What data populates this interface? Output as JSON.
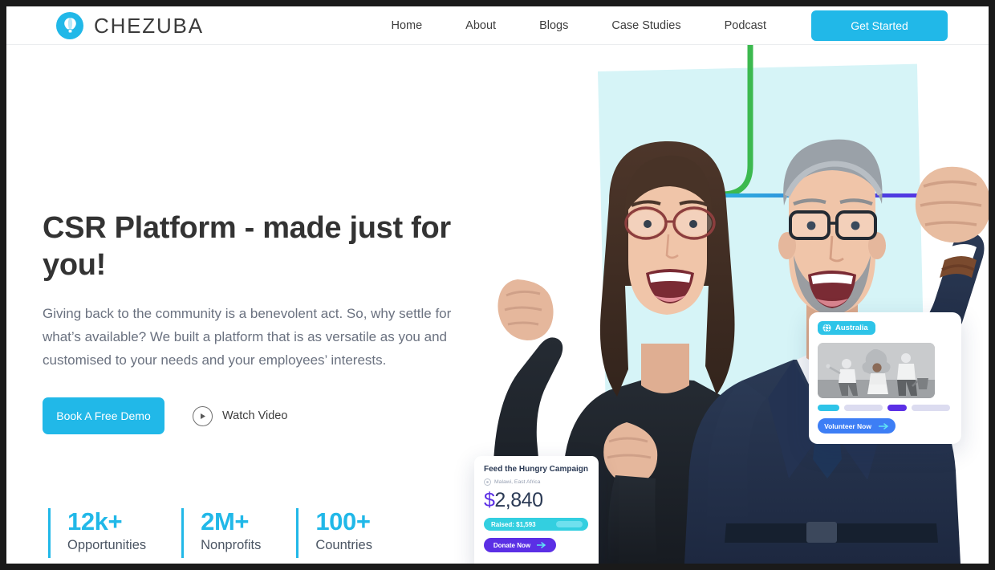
{
  "header": {
    "brand_name": "CHEZUBA",
    "logo_icon": "hot-air-balloon-icon",
    "nav": [
      {
        "label": "Home"
      },
      {
        "label": "About"
      },
      {
        "label": "Blogs"
      },
      {
        "label": "Case Studies"
      },
      {
        "label": "Podcast"
      }
    ],
    "cta_label": "Get Started"
  },
  "hero": {
    "title": "CSR Platform - made just for you!",
    "subtitle": "Giving back to the community is a benevolent act. So, why settle for what’s available? We built a platform that is as versatile as you and customised to your needs and your employees’ interests.",
    "primary_cta": "Book A Free Demo",
    "secondary_cta": "Watch Video",
    "play_icon": "play-icon"
  },
  "stats": [
    {
      "value": "12k+",
      "label": "Opportunities"
    },
    {
      "value": "2M+",
      "label": "Nonprofits"
    },
    {
      "value": "100+",
      "label": "Countries"
    }
  ],
  "cards": {
    "volunteer": {
      "country_badge": "Australia",
      "globe_icon": "globe-icon",
      "cta_label": "Volunteer Now",
      "arrow_icon": "arrow-right-icon"
    },
    "campaign": {
      "title": "Feed the Hungry Campaign",
      "location": "Malawi, East Africa",
      "location_icon": "map-pin-icon",
      "currency": "$",
      "amount": "2,840",
      "raised_label": "Raised: $1,593",
      "cta_label": "Donate Now",
      "arrow_icon": "arrow-right-icon"
    }
  },
  "colors": {
    "brand_cyan": "#21b8e8",
    "mint_panel": "#d6f4f7",
    "accent_purple": "#5b2fe5",
    "accent_blue": "#3d7ef5",
    "accent_green": "#3cb94f",
    "heading": "#333333",
    "body_text": "#6b7280"
  }
}
